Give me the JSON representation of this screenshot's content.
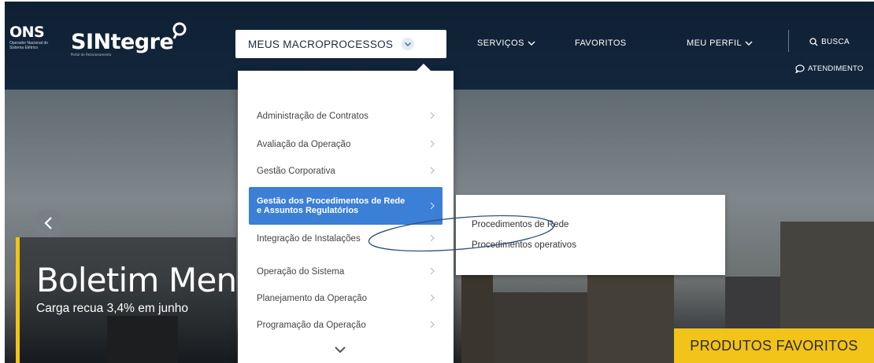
{
  "brand": {
    "ons": "ONS",
    "ons_tagline": "Operador Nacional do Sistema Elétrico",
    "portal": "SINtegre",
    "portal_tagline": "Portal de Relacionamento"
  },
  "nav": {
    "macro_label": "MEUS MACROPROCESSOS",
    "servicos": "SERVIÇOS",
    "favoritos": "FAVORITOS",
    "perfil": "MEU PERFIL",
    "busca": "BUSCA",
    "atendimento": "ATENDIMENTO"
  },
  "dropdown": {
    "items": [
      {
        "label": "Administração de Contratos"
      },
      {
        "label": "Avaliação da Operação"
      },
      {
        "label": "Gestão Corporativa"
      },
      {
        "label": "Gestão dos Procedimentos de Rede e Assuntos Regulatórios",
        "active": true
      },
      {
        "label": "Integração de Instalações"
      },
      {
        "label": "Operação do Sistema"
      },
      {
        "label": "Planejamento da Operação"
      },
      {
        "label": "Programação da Operação"
      }
    ],
    "submenu": [
      {
        "label": "Procedimentos de Rede"
      },
      {
        "label": "Procedimentos operativos"
      }
    ]
  },
  "hero": {
    "title": "Boletim Mensa",
    "subtitle": "Carga recua 3,4% em junho",
    "fav_button": "PRODUTOS FAVORITOS"
  },
  "colors": {
    "accent": "#3b7fd6",
    "highlight": "#f2c318",
    "navbar": "#12263c"
  },
  "icons": [
    "chevron-down-icon",
    "chevron-right-icon",
    "chevron-left-icon",
    "search-icon",
    "chat-icon",
    "pin-icon"
  ]
}
